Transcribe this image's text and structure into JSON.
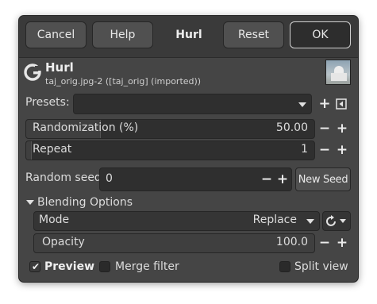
{
  "header": {
    "cancel_label": "Cancel",
    "help_label": "Help",
    "title": "Hurl",
    "reset_label": "Reset",
    "ok_label": "OK"
  },
  "plugin": {
    "name": "Hurl",
    "image_info": "taj_orig.jpg-2 ([taj_orig] (imported))"
  },
  "presets": {
    "label": "Presets:",
    "value": "",
    "add_icon": "plus-icon",
    "menu_icon": "menu-arrow-icon"
  },
  "randomization": {
    "label": "Randomization (%)",
    "value": "50.00",
    "fraction": 0.5
  },
  "repeat": {
    "label": "Repeat",
    "value": "1",
    "fraction": 0.0
  },
  "random_seed": {
    "label": "Random seed",
    "value": "0",
    "new_seed_label": "New Seed"
  },
  "blending": {
    "label": "Blending Options",
    "mode_label": "Mode",
    "mode_value": "Replace",
    "opacity_label": "Opacity",
    "opacity_value": "100.0",
    "opacity_fraction": 1.0
  },
  "footer": {
    "preview_label": "Preview",
    "preview_checked": true,
    "merge_label": "Merge filter",
    "merge_checked": false,
    "split_label": "Split view",
    "split_checked": false
  }
}
